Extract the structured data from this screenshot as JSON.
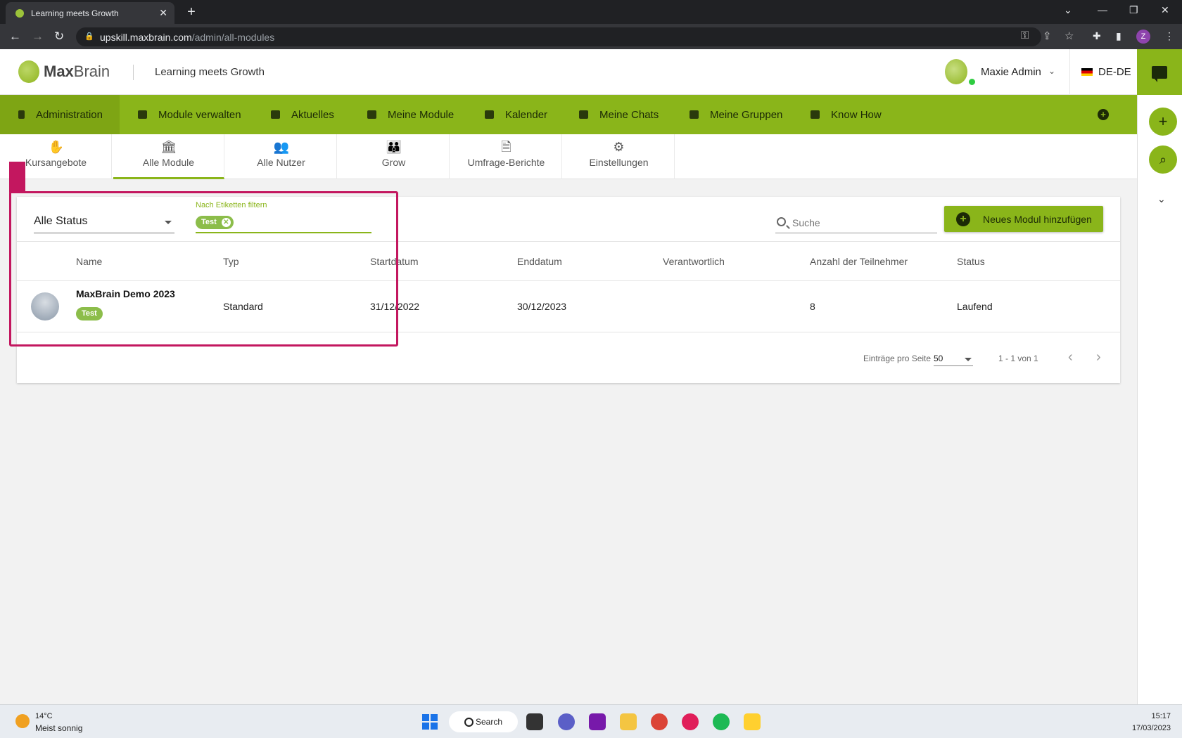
{
  "browser": {
    "tab_title": "Learning meets Growth",
    "tab_close": "✕",
    "new_tab": "+",
    "url_host": "upskill.maxbrain.com",
    "url_path": "/admin/all-modules",
    "profile_initial": "Z"
  },
  "header": {
    "brand_bold": "Max",
    "brand_rest": "Brain",
    "title": "Learning meets Growth",
    "user_name": "Maxie Admin",
    "language": "DE-DE"
  },
  "main_nav": {
    "items": [
      {
        "label": "Administration",
        "active": true
      },
      {
        "label": "Module verwalten"
      },
      {
        "label": "Aktuelles"
      },
      {
        "label": "Meine Module"
      },
      {
        "label": "Kalender"
      },
      {
        "label": "Meine Chats"
      },
      {
        "label": "Meine Gruppen"
      },
      {
        "label": "Know How"
      }
    ]
  },
  "sub_tabs": {
    "items": [
      {
        "label": "Kursangebote"
      },
      {
        "label": "Alle Module",
        "active": true
      },
      {
        "label": "Alle Nutzer"
      },
      {
        "label": "Grow"
      },
      {
        "label": "Umfrage-Berichte"
      },
      {
        "label": "Einstellungen"
      }
    ]
  },
  "filters": {
    "status_value": "Alle Status",
    "tag_filter_label": "Nach Etiketten filtern",
    "tag_chip": "Test",
    "search_placeholder": "Suche",
    "add_button": "Neues Modul hinzufügen"
  },
  "table": {
    "columns": [
      "Name",
      "Typ",
      "Startdatum",
      "Enddatum",
      "Verantwortlich",
      "Anzahl der Teilnehmer",
      "Status"
    ],
    "rows": [
      {
        "name": "MaxBrain Demo 2023",
        "tag": "Test",
        "type": "Standard",
        "start": "31/12/2022",
        "end": "30/12/2023",
        "responsible": "",
        "participants": "8",
        "status": "Laufend"
      }
    ]
  },
  "pagination": {
    "per_page_label": "Einträge pro Seite",
    "per_page_value": "50",
    "range": "1 - 1 von 1"
  },
  "taskbar": {
    "temp": "14°C",
    "weather": "Meist sonnig",
    "search": "Search",
    "time": "15:17",
    "date": "17/03/2023"
  },
  "colors": {
    "accent": "#8ab51a",
    "highlight": "#c3175f",
    "chip": "#8cbd4a"
  }
}
